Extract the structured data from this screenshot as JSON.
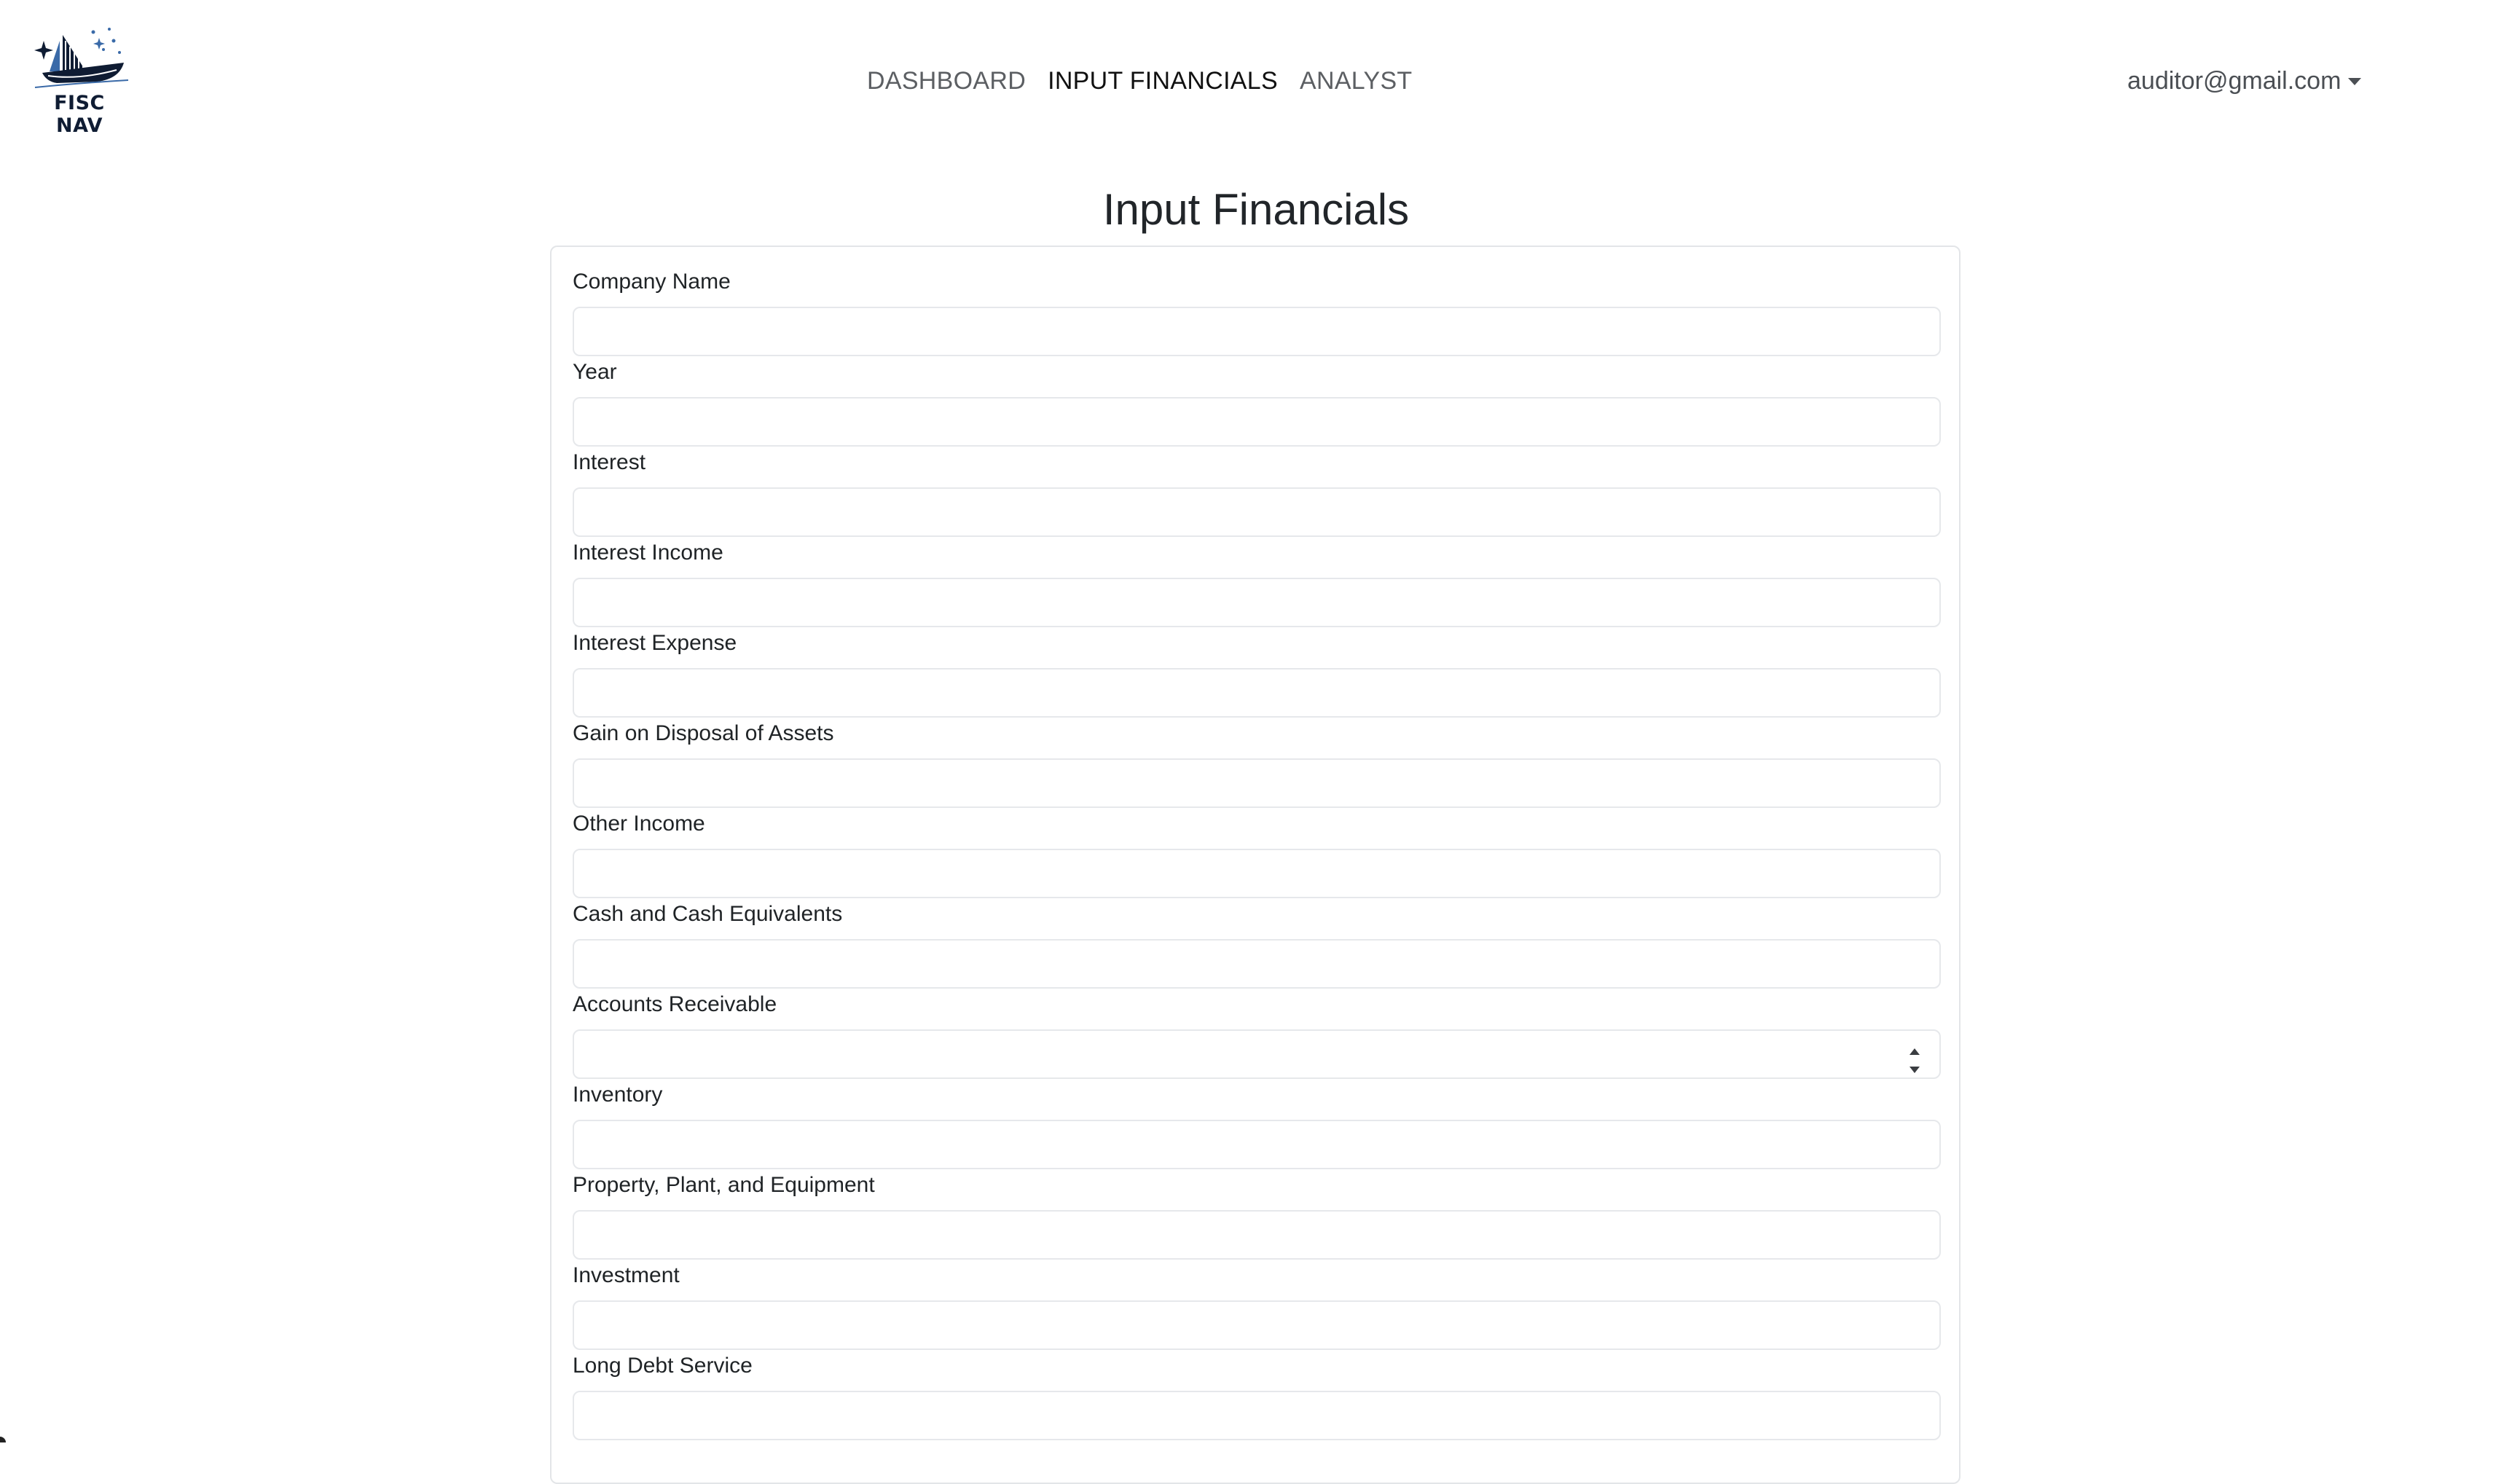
{
  "brand": {
    "name": "FISC NAV",
    "logo_icon": "sailboat-logo-icon"
  },
  "nav": {
    "links": [
      {
        "label": "DASHBOARD",
        "active": false
      },
      {
        "label": "INPUT FINANCIALS",
        "active": true
      },
      {
        "label": "ANALYST",
        "active": false
      }
    ]
  },
  "user": {
    "email": "auditor@gmail.com",
    "menu_icon": "caret-down-icon"
  },
  "page": {
    "title": "Input Financials"
  },
  "form": {
    "fields": [
      {
        "label": "Company Name",
        "value": ""
      },
      {
        "label": "Year",
        "value": ""
      },
      {
        "label": "Interest",
        "value": ""
      },
      {
        "label": "Interest Income",
        "value": ""
      },
      {
        "label": "Interest Expense",
        "value": ""
      },
      {
        "label": "Gain on Disposal of Assets",
        "value": ""
      },
      {
        "label": "Other Income",
        "value": ""
      },
      {
        "label": "Cash and Cash Equivalents",
        "value": ""
      },
      {
        "label": "Accounts Receivable",
        "value": "",
        "focused_spinner": true
      },
      {
        "label": "Inventory",
        "value": ""
      },
      {
        "label": "Property, Plant, and Equipment",
        "value": ""
      },
      {
        "label": "Investment",
        "value": ""
      },
      {
        "label": "Long Debt Service",
        "value": ""
      }
    ]
  },
  "colors": {
    "brand_navy": "#0f1c33",
    "nav_text": "#5c5f63",
    "nav_active": "#111111",
    "border": "#e3e5e8"
  }
}
